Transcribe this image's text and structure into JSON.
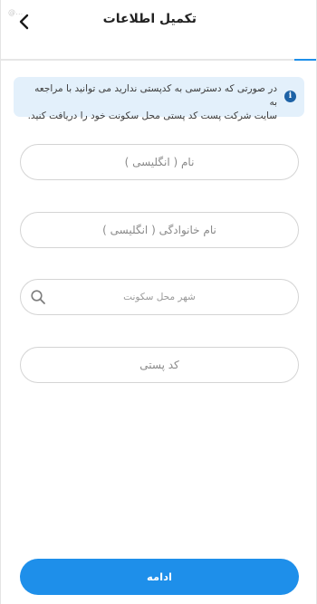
{
  "status_bar": {
    "watermark": "@..."
  },
  "header": {
    "title": "تکمیل اطلاعات",
    "back_icon": "chevron-left-icon"
  },
  "progress": {
    "fraction": 0.07
  },
  "info": {
    "icon": "info-icon",
    "icon_glyph": "i",
    "line1": "در صورتی که دسترسی به کدپستی ندارید می توانید با مراجعه به",
    "line2": "سایت شرکت پست کد پستی محل سکونت خود را دریافت کنید."
  },
  "form": {
    "first_name": {
      "placeholder": "نام ( انگلیسی )",
      "value": ""
    },
    "last_name": {
      "placeholder": "نام خانوادگی ( انگلیسی )",
      "value": ""
    },
    "city": {
      "placeholder": "شهر محل سکونت",
      "value": "",
      "icon": "search-icon"
    },
    "postal_code": {
      "placeholder": "کد پستی",
      "value": ""
    }
  },
  "actions": {
    "continue_label": "ادامه"
  },
  "colors": {
    "accent": "#1e8fea",
    "info_background": "#e3f0fb",
    "info_icon": "#1d62a6",
    "field_border": "#d4d4d4"
  }
}
